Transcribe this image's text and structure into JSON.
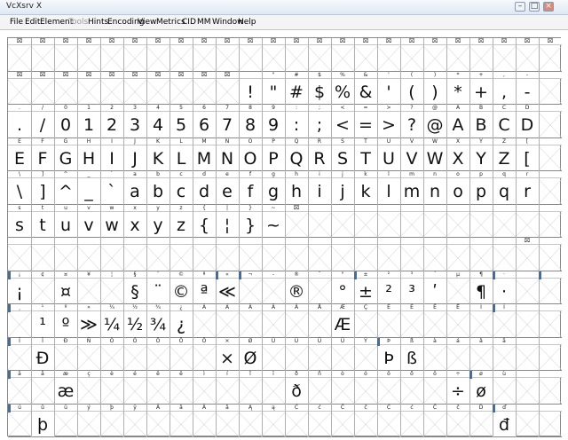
{
  "window": {
    "title": "VcXsrv X"
  },
  "menu": [
    "File",
    "Edit",
    "Element",
    "Tools",
    "Hints",
    "Encoding",
    "View",
    "Metrics",
    "CID",
    "MM",
    "Window",
    "Help"
  ],
  "menu_disabled": [
    "Tools"
  ],
  "grid": {
    "rows": [
      {
        "labels": [
          "⌧",
          "⌧",
          "⌧",
          "⌧",
          "⌧",
          "⌧",
          "⌧",
          "⌧",
          "⌧",
          "⌧",
          "⌧",
          "⌧",
          "⌧",
          "⌧",
          "⌧",
          "⌧",
          "⌧",
          "⌧",
          "⌧",
          "⌧",
          "⌧",
          "⌧",
          "⌧",
          "⌧"
        ],
        "glyphs": [
          "",
          "",
          "",
          "",
          "",
          "",
          "",
          "",
          "",
          "",
          "",
          "",
          "",
          "",
          "",
          "",
          "",
          "",
          "",
          "",
          "",
          "",
          "",
          ""
        ]
      },
      {
        "labels": [
          "⌧",
          "⌧",
          "⌧",
          "⌧",
          "⌧",
          "⌧",
          "⌧",
          "⌧",
          "⌧",
          "⌧",
          "",
          "\"",
          "#",
          "$",
          "%",
          "&",
          "'",
          "(",
          ")",
          "*",
          "+",
          ",",
          "-",
          ""
        ],
        "glyphs": [
          "",
          "",
          "",
          "",
          "",
          "",
          "",
          "",
          "",
          "",
          "!",
          "\"",
          "#",
          "$",
          "%",
          "&",
          "'",
          "(",
          ")",
          "*",
          "+",
          ",",
          "-",
          ""
        ]
      },
      {
        "labels": [
          ".",
          "/",
          "0",
          "1",
          "2",
          "3",
          "4",
          "5",
          "6",
          "7",
          "8",
          "9",
          ":",
          ";",
          "<",
          "=",
          ">",
          "?",
          "@",
          "A",
          "B",
          "C",
          "D",
          ""
        ],
        "glyphs": [
          ".",
          "/",
          "0",
          "1",
          "2",
          "3",
          "4",
          "5",
          "6",
          "7",
          "8",
          "9",
          ":",
          ";",
          "<",
          "=",
          ">",
          "?",
          "@",
          "A",
          "B",
          "C",
          "D",
          ""
        ]
      },
      {
        "labels": [
          "E",
          "F",
          "G",
          "H",
          "I",
          "J",
          "K",
          "L",
          "M",
          "N",
          "O",
          "P",
          "Q",
          "R",
          "S",
          "T",
          "U",
          "V",
          "W",
          "X",
          "Y",
          "Z",
          "[",
          ""
        ],
        "glyphs": [
          "E",
          "F",
          "G",
          "H",
          "I",
          "J",
          "K",
          "L",
          "M",
          "N",
          "O",
          "P",
          "Q",
          "R",
          "S",
          "T",
          "U",
          "V",
          "W",
          "X",
          "Y",
          "Z",
          "[",
          ""
        ]
      },
      {
        "labels": [
          "\\",
          "]",
          "^",
          "_",
          "`",
          "a",
          "b",
          "c",
          "d",
          "e",
          "f",
          "g",
          "h",
          "i",
          "j",
          "k",
          "l",
          "m",
          "n",
          "o",
          "p",
          "q",
          "r",
          ""
        ],
        "glyphs": [
          "\\",
          "]",
          "^",
          "_",
          "`",
          "a",
          "b",
          "c",
          "d",
          "e",
          "f",
          "g",
          "h",
          "i",
          "j",
          "k",
          "l",
          "m",
          "n",
          "o",
          "p",
          "q",
          "r",
          ""
        ]
      },
      {
        "labels": [
          "s",
          "t",
          "u",
          "v",
          "w",
          "x",
          "y",
          "z",
          "{",
          "|",
          "}",
          "~",
          "⌧",
          "",
          "",
          "",
          "",
          "",
          "",
          "",
          "",
          "",
          "",
          ""
        ],
        "glyphs": [
          "s",
          "t",
          "u",
          "v",
          "w",
          "x",
          "y",
          "z",
          "{",
          "¦",
          "}",
          "~",
          "",
          "",
          "",
          "",
          "",
          "",
          "",
          "",
          "",
          "",
          "",
          ""
        ]
      },
      {
        "labels": [
          "",
          "",
          "",
          "",
          "",
          "",
          "",
          "",
          "",
          "",
          "",
          "",
          "",
          "",
          "",
          "",
          "",
          "",
          "",
          "",
          "",
          "",
          "⌧",
          ""
        ],
        "glyphs": [
          "",
          "",
          "",
          "",
          "",
          "",
          "",
          "",
          "",
          "",
          "",
          "",
          "",
          "",
          "",
          "",
          "",
          "",
          "",
          "",
          "",
          "",
          "",
          ""
        ]
      },
      {
        "labels": [
          "¡",
          "¢",
          "¤",
          "¥",
          "¦",
          "§",
          "¨",
          "©",
          "ª",
          "«",
          "¬",
          "-",
          "®",
          "¯",
          "°",
          "±",
          "²",
          "³",
          "´",
          "µ",
          "¶",
          "·",
          "",
          ""
        ],
        "glyphs": [
          "¡",
          "",
          "¤",
          "",
          "",
          "§",
          "¨",
          "©",
          "ª",
          "≪",
          "",
          "",
          "®",
          "",
          "°",
          "±",
          "²",
          "³",
          "ʹ",
          "",
          "¶",
          "·",
          "",
          ""
        ]
      },
      {
        "labels": [
          "¸",
          "¹",
          "º",
          "»",
          "¼",
          "½",
          "¾",
          "¿",
          "À",
          "Á",
          "Â",
          "Ã",
          "Ä",
          "Å",
          "Æ",
          "Ç",
          "È",
          "É",
          "Ê",
          "Ë",
          "Ì",
          "Í",
          "",
          ""
        ],
        "glyphs": [
          "",
          "¹",
          "º",
          "≫",
          "¼",
          "½",
          "¾",
          "¿",
          "",
          "",
          "",
          "",
          "",
          "",
          "Æ",
          "",
          "",
          "",
          "",
          "",
          "",
          "",
          "",
          ""
        ]
      },
      {
        "labels": [
          "Î",
          "Ï",
          "Ð",
          "Ñ",
          "Ò",
          "Ó",
          "Ô",
          "Õ",
          "Ö",
          "×",
          "Ø",
          "Ù",
          "Ú",
          "Û",
          "Ü",
          "Ý",
          "Þ",
          "ß",
          "à",
          "á",
          "â",
          "ã",
          "",
          ""
        ],
        "glyphs": [
          "",
          "Đ",
          "",
          "",
          "",
          "",
          "",
          "",
          "",
          "×",
          "Ø",
          "",
          "",
          "",
          "",
          "",
          "Þ",
          "ß",
          "",
          "",
          "",
          "",
          "",
          ""
        ]
      },
      {
        "labels": [
          "ä",
          "å",
          "æ",
          "ç",
          "è",
          "é",
          "ê",
          "ë",
          "ì",
          "í",
          "î",
          "ï",
          "ð",
          "ñ",
          "ò",
          "ó",
          "ô",
          "õ",
          "ö",
          "÷",
          "ø",
          "ù",
          "",
          ""
        ],
        "glyphs": [
          "",
          "",
          "æ",
          "",
          "",
          "",
          "",
          "",
          "",
          "",
          "",
          "",
          "ð",
          "",
          "",
          "",
          "",
          "",
          "",
          "÷",
          "ø",
          "",
          "",
          ""
        ]
      },
      {
        "labels": [
          "ú",
          "û",
          "ü",
          "ý",
          "þ",
          "ÿ",
          "Ā",
          "ā",
          "Ă",
          "ă",
          "Ą",
          "ą",
          "Ć",
          "ć",
          "Ĉ",
          "ĉ",
          "Ċ",
          "ċ",
          "Č",
          "č",
          "Ď",
          "ď",
          "",
          ""
        ],
        "glyphs": [
          "",
          "þ",
          "",
          "",
          "",
          "",
          "",
          "",
          "",
          "",
          "",
          "",
          "",
          "",
          "",
          "",
          "",
          "",
          "",
          "",
          "",
          "đ",
          "",
          ""
        ]
      }
    ]
  }
}
